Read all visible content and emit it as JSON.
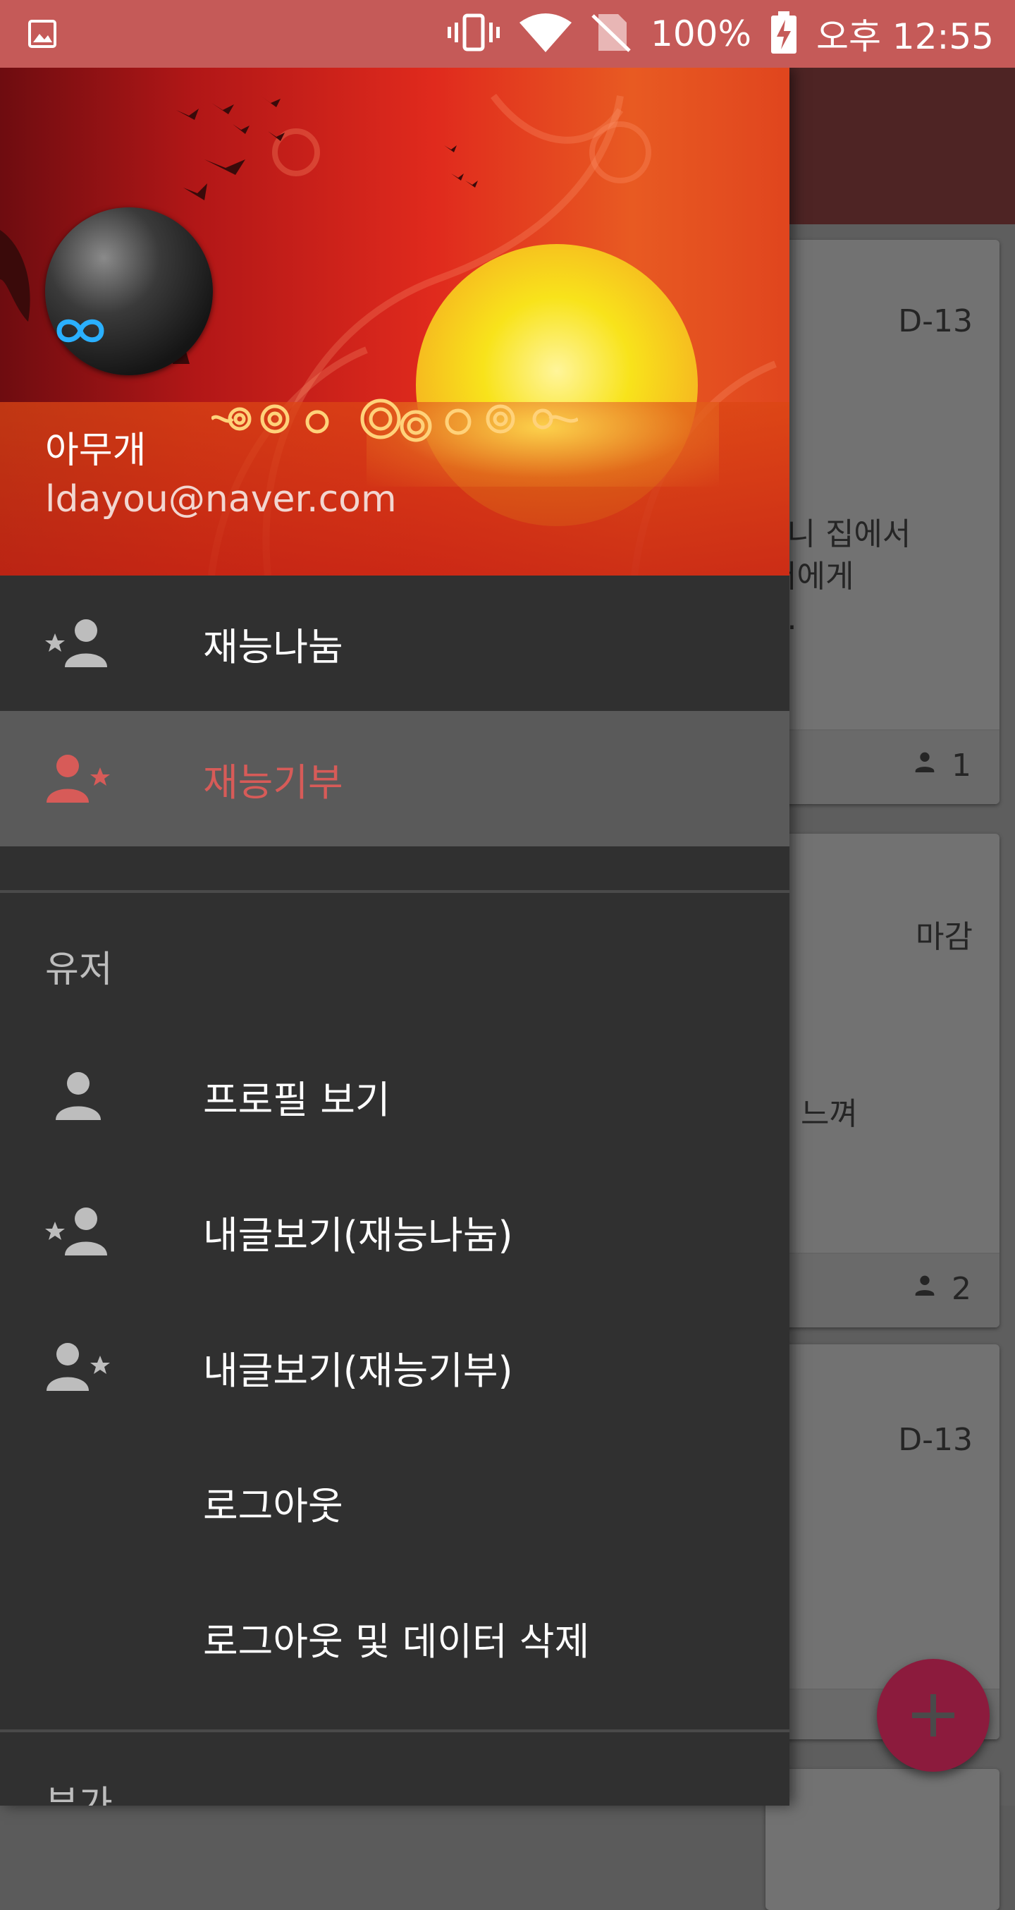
{
  "status_bar": {
    "battery": "100%",
    "time": "오후 12:55"
  },
  "drawer": {
    "header": {
      "user_name": "아무개",
      "user_email": "ldayou@naver.com"
    },
    "primary_items": [
      {
        "label": "재능나눔",
        "icon": "person-star-left-icon",
        "active": false
      },
      {
        "label": "재능기부",
        "icon": "person-star-right-icon",
        "active": true
      }
    ],
    "user_section": {
      "title": "유저",
      "items": [
        {
          "label": "프로필 보기",
          "icon": "person-icon"
        },
        {
          "label": "내글보기(재능나눔)",
          "icon": "person-star-left-icon"
        },
        {
          "label": "내글보기(재능기부)",
          "icon": "person-star-right-icon"
        },
        {
          "label": "로그아웃",
          "icon": ""
        },
        {
          "label": "로그아웃 및 데이터 삭제",
          "icon": ""
        }
      ]
    },
    "extra_section": {
      "title": "부가"
    }
  },
  "background": {
    "cards": [
      {
        "badge": "D-13",
        "text": "으니 집에서\n 저에게\n다.\n고",
        "count": "1"
      },
      {
        "badge": "마감",
        "text": "느껴",
        "count": "2"
      },
      {
        "badge": "D-13",
        "text": "",
        "count": ""
      }
    ]
  },
  "colors": {
    "status_bar": "#c55a58",
    "accent": "#d75b58",
    "drawer_bg": "#303030",
    "fab": "#8c1b3d"
  }
}
